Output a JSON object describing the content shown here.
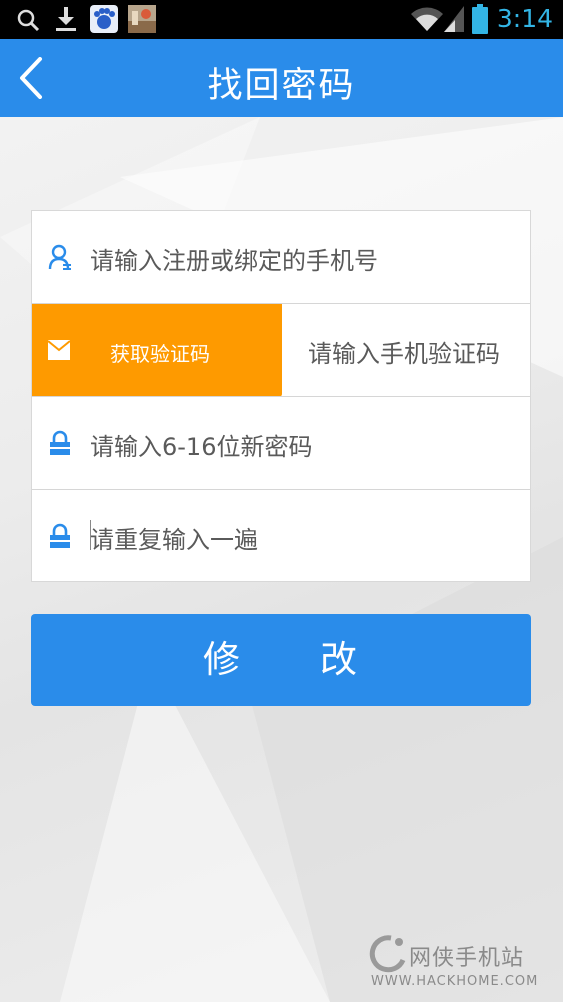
{
  "status_bar": {
    "time": "3:14",
    "icons": [
      "search-icon",
      "download-icon",
      "baidu-app-icon",
      "photo-thumbnail-icon",
      "wifi-icon",
      "signal-icon",
      "battery-icon"
    ]
  },
  "header": {
    "title": "找回密码",
    "back_icon": "chevron-left-icon"
  },
  "form": {
    "phone_placeholder": "请输入注册或绑定的手机号",
    "get_code_button": "获取验证码",
    "code_placeholder": "请输入手机验证码",
    "new_password_placeholder": "请输入6-16位新密码",
    "repeat_password_placeholder": "请重复输入一遍"
  },
  "submit_button": "修　　改",
  "watermark": {
    "name": "网侠手机站",
    "url": "WWW.HACKHOME.COM"
  },
  "colors": {
    "accent": "#2a8cea",
    "code_button": "#fe9a00",
    "status_time": "#33b5e5"
  }
}
